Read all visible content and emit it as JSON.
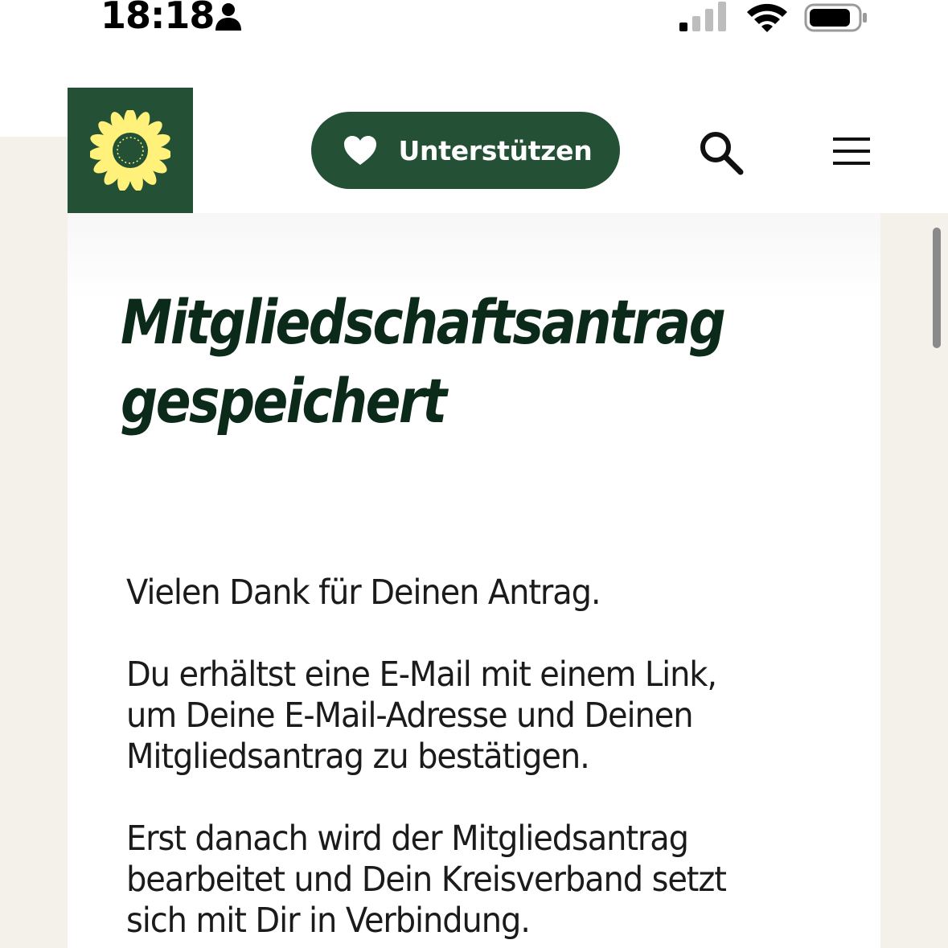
{
  "status_bar": {
    "time": "18:18",
    "icons": [
      "person-icon",
      "cellular-signal-icon",
      "wifi-icon",
      "battery-icon"
    ]
  },
  "header": {
    "logo": "sunflower-logo",
    "support_button_label": "Unterstützen",
    "support_icon": "heart-icon",
    "search_icon": "search-icon",
    "menu_icon": "hamburger-menu-icon"
  },
  "main": {
    "title": "Mitgliedschaftsantrag gespeichert",
    "paragraphs": [
      "Vielen Dank für Deinen Antrag.",
      "Du erhältst eine E-Mail mit einem Link,\num Deine E-Mail-Adresse und Deinen\nMitgliedsantrag zu bestätigen.",
      "Erst danach wird der Mitgliedsantrag\nbearbeitet und Dein Kreisverband setzt\nsich mit Dir in Verbindung."
    ]
  },
  "colors": {
    "brand_green": "#245135",
    "sunflower_yellow": "#fff17a",
    "background_sand": "#f3f1ea",
    "title_text": "#0b2a1a"
  }
}
